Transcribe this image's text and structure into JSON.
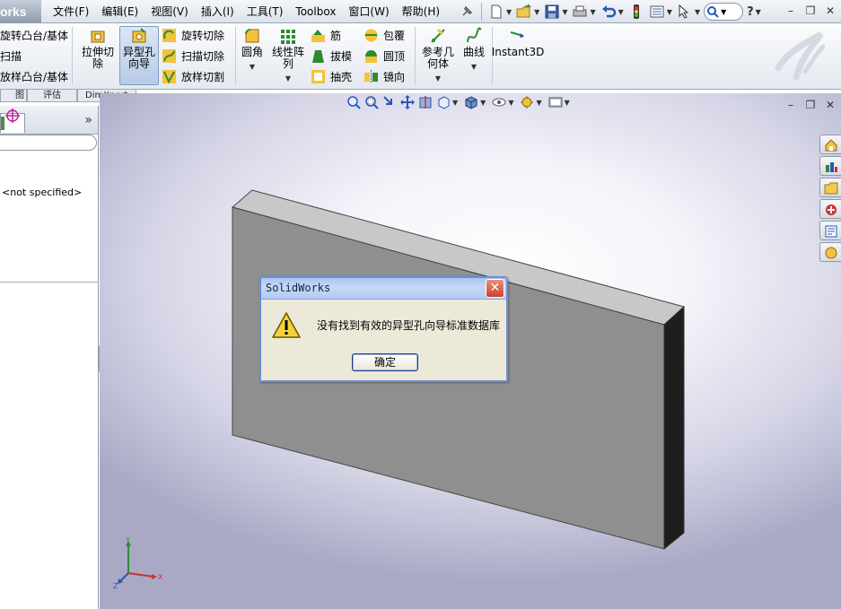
{
  "app": {
    "logo_text": "orks"
  },
  "menu": {
    "items": [
      "文件(F)",
      "编辑(E)",
      "视图(V)",
      "插入(I)",
      "工具(T)",
      "Toolbox",
      "窗口(W)",
      "帮助(H)"
    ]
  },
  "quickbar": {
    "search_placeholder": "",
    "help_label": "?"
  },
  "ribbon": {
    "left_column": [
      "旋转凸台/基体",
      "扫描",
      "放样凸台/基体"
    ],
    "extrude_cut": "拉伸切\n除",
    "hole_wizard": "异型孔\n向导",
    "cut_column": [
      "旋转切除",
      "扫描切除",
      "放样切割"
    ],
    "fillet": "圆角",
    "linear_pattern": "线性阵\n列",
    "feat_col1": [
      "筋",
      "拔模",
      "抽壳"
    ],
    "feat_col2": [
      "包覆",
      "圆顶",
      "镜向"
    ],
    "ref_geometry": "参考几\n何体",
    "curves": "曲线",
    "instant3d": "Instant3D"
  },
  "cmd_tabs": [
    "图",
    "评估",
    "DimXpert"
  ],
  "left_panel": {
    "material": "<not specified>",
    "expand_label": "»"
  },
  "dialog": {
    "title": "SolidWorks",
    "message": "没有找到有效的异型孔向导标准数据库",
    "ok_label": "确定",
    "close_label": "✕"
  },
  "colors": {
    "menubar": "#e6ebf2",
    "dialog_border": "#6b8ed8",
    "dialog_bg": "#ece9d8",
    "part_front": "#8f8f8f",
    "part_top": "#c8c8c8",
    "part_side": "#1e1e1e"
  },
  "icons": {
    "quickbar": [
      "new-icon",
      "open-icon",
      "save-icon",
      "print-icon",
      "undo-icon",
      "rebuild-icon",
      "options-icon",
      "select-icon",
      "search-icon",
      "help-icon"
    ],
    "view_toolbar": [
      "zoom-fit-icon",
      "zoom-area-icon",
      "previous-view-icon",
      "section-view-icon",
      "view-orientation-icon",
      "display-style-icon",
      "hide-show-icon",
      "edit-appearance-icon",
      "apply-scene-icon"
    ],
    "task_pane": [
      "solidworks-resources-icon",
      "design-library-icon",
      "file-explorer-icon",
      "view-palette-icon",
      "appearances-icon",
      "custom-properties-icon"
    ]
  }
}
